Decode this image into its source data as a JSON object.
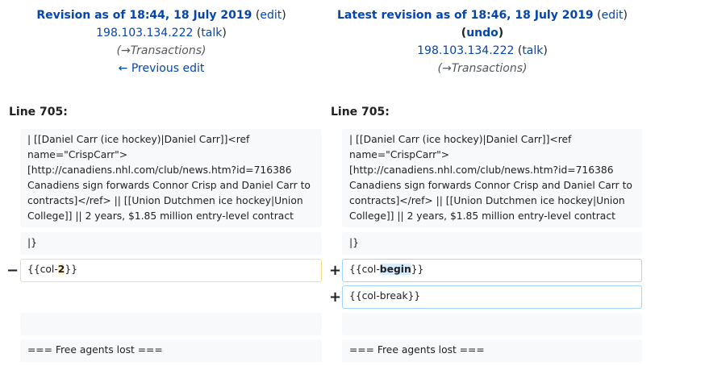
{
  "left_header": {
    "title": "Revision as of 18:44, 18 July 2019",
    "edit": "edit",
    "user": "198.103.134.222",
    "talk": "talk",
    "summary_arrow": "(→",
    "summary": "Transactions",
    "summary_close": ")",
    "prev": "← Previous edit"
  },
  "right_header": {
    "title": "Latest revision as of 18:46, 18 July 2019",
    "edit": "edit",
    "undo": "undo",
    "user": "198.103.134.222",
    "talk": "talk",
    "summary_arrow": "(→",
    "summary": "Transactions",
    "summary_close": ")"
  },
  "line_left": "Line 705:",
  "line_right": "Line 705:",
  "context_block": "| [[Daniel Carr (ice hockey)|Daniel Carr]]<ref\nname=\"CrispCarr\">\n[http://canadiens.nhl.com/club/news.htm?id=716386\nCanadiens sign forwards Connor Crisp and Daniel Carr to\ncontracts]</ref> || [[Union Dutchmen ice hockey|Union\nCollege]] || 2 years, $1.85 million entry-level contract",
  "close_table": "|}",
  "deleted_line": {
    "prefix": "{{col-",
    "changed": "2",
    "suffix": "}}"
  },
  "added_line_1": {
    "prefix": "{{col-",
    "changed": "begin",
    "suffix": "}}"
  },
  "added_line_2": "{{col-break}}",
  "free_agents": "=== Free agents lost ===",
  "markers": {
    "minus": "−",
    "plus": "+"
  },
  "colors": {
    "link": "#0645ad",
    "deleted_border": "#fedc8a",
    "added_border": "#a3d3ff",
    "context_bg": "#f8f9fa"
  }
}
